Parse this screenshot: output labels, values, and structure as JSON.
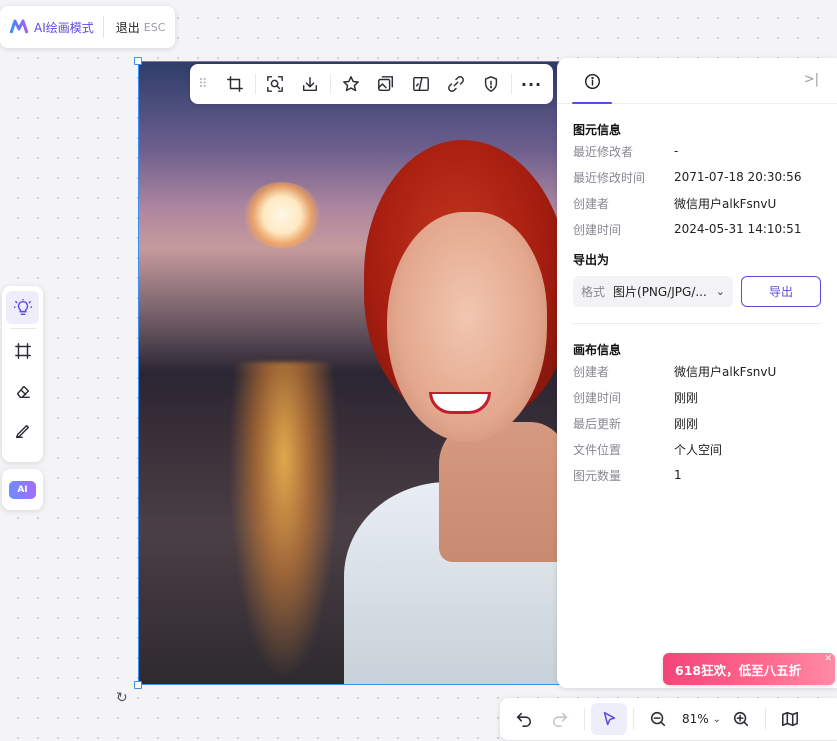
{
  "mode_badge": {
    "title": "AI绘画模式",
    "exit_label": "退出",
    "exit_key": "ESC",
    "icon": "logo-icon"
  },
  "image_toolbar": {
    "items": [
      {
        "name": "drag-handle-icon"
      },
      {
        "name": "crop-icon"
      },
      {
        "name": "zoom-fit-icon"
      },
      {
        "name": "download-icon"
      },
      {
        "name": "star-icon"
      },
      {
        "name": "image-replace-icon"
      },
      {
        "name": "image-split-icon"
      },
      {
        "name": "link-icon"
      },
      {
        "name": "shield-icon"
      },
      {
        "name": "more-icon",
        "label": "···"
      }
    ]
  },
  "tool_rail": {
    "items": [
      "lightbulb-icon",
      "crop-frame-icon",
      "eraser-icon",
      "brush-icon"
    ],
    "ai_label": "AI"
  },
  "info_panel": {
    "tab_icon": "info-icon",
    "collapse_icon": ">|",
    "element_info": {
      "title": "图元信息",
      "rows": [
        {
          "k": "最近修改者",
          "v": "-"
        },
        {
          "k": "最近修改时间",
          "v": "2071-07-18 20:30:56"
        },
        {
          "k": "创建者",
          "v": "微信用户alkFsnvU"
        },
        {
          "k": "创建时间",
          "v": "2024-05-31 14:10:51"
        }
      ]
    },
    "export": {
      "title": "导出为",
      "format_label": "格式",
      "format_value": "图片(PNG/JPG/...",
      "button": "导出"
    },
    "canvas_info": {
      "title": "画布信息",
      "rows": [
        {
          "k": "创建者",
          "v": "微信用户alkFsnvU"
        },
        {
          "k": "创建时间",
          "v": "刚刚"
        },
        {
          "k": "最后更新",
          "v": "刚刚"
        },
        {
          "k": "文件位置",
          "v": "个人空间"
        },
        {
          "k": "图元数量",
          "v": "1"
        }
      ]
    }
  },
  "promo": {
    "text": "618狂欢，低至八五折",
    "close": "✕"
  },
  "bottom_bar": {
    "zoom": "81%"
  },
  "colors": {
    "accent": "#5b4be0",
    "selection": "#3d8ef7",
    "promo": "#f5447a"
  }
}
